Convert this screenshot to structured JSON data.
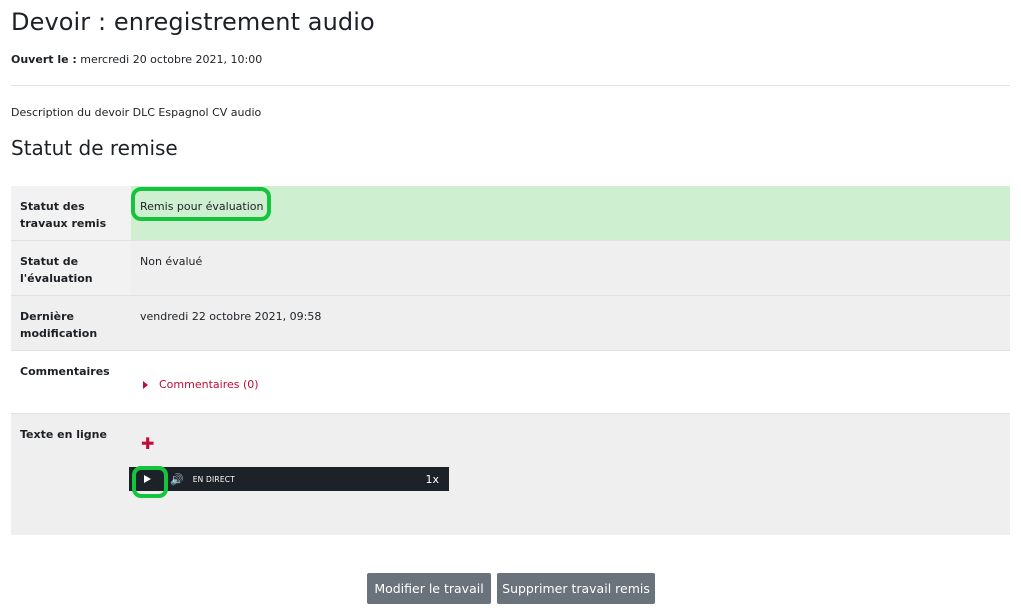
{
  "page": {
    "title": "Devoir : enregistrement audio",
    "opened_label": "Ouvert le :",
    "opened_value": "mercredi 20 octobre 2021, 10:00",
    "description": "Description du devoir DLC Espagnol CV audio",
    "section_title": "Statut de remise"
  },
  "status": {
    "rows": [
      {
        "label": "Statut des travaux remis",
        "value": "Remis pour évaluation"
      },
      {
        "label": "Statut de l'évaluation",
        "value": "Non évalué"
      },
      {
        "label": "Dernière modification",
        "value": "vendredi 22 octobre 2021, 09:58"
      },
      {
        "label": "Commentaires",
        "value": "Commentaires (0)"
      },
      {
        "label": "Texte en ligne",
        "value": ""
      }
    ]
  },
  "player": {
    "live_label": "EN DIRECT",
    "rate": "1x",
    "play_icon": "play-icon",
    "volume_icon": "volume-icon"
  },
  "actions": {
    "edit_label": "Modifier le travail",
    "remove_label": "Supprimer travail remis"
  },
  "colors": {
    "submitted_bg": "#cfefd1",
    "highlight": "#14c43d",
    "link": "#c00d38",
    "button": "#6a737b"
  }
}
